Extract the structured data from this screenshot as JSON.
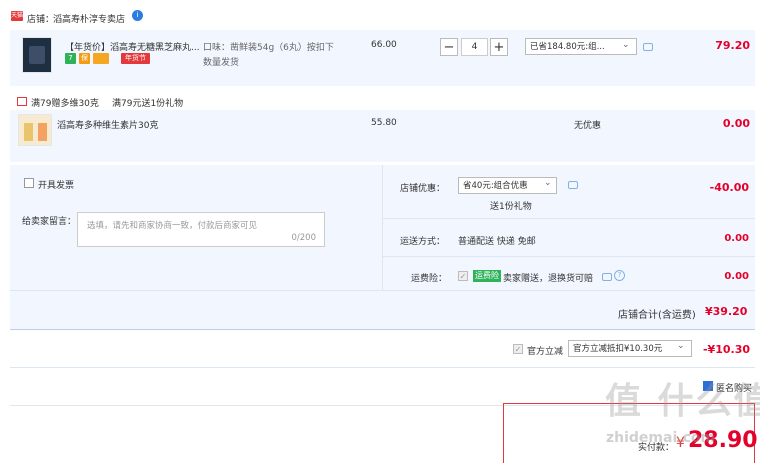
{
  "store": {
    "badge": "天猫",
    "label": "店铺：",
    "name": "滔高寿朴淳专卖店",
    "badge2": "i"
  },
  "item1": {
    "title": "【年货价】滔高寿无糖黑芝麻丸...",
    "tags": [
      "7",
      "保",
      "",
      "年货节"
    ],
    "spec": "口味：凿鲜装54g（6丸）按扣下",
    "spec2": "数量发货",
    "price": "66.00",
    "qty": "4",
    "qty_minus": "−",
    "qty_plus": "+",
    "discount": "已省184.80元:组...",
    "subtotal": "79.20"
  },
  "promo": {
    "text1": "满79赠多维30克",
    "text2": "满79元送1份礼物"
  },
  "item2": {
    "title": "滔高寿多种维生素片30克",
    "price": "55.80",
    "discount": "无优惠",
    "subtotal": "0.00"
  },
  "invoice": {
    "label": "开具发票"
  },
  "message": {
    "label": "给卖家留言：",
    "placeholder": "选填，请先和商家协商一致，付款后商家可见",
    "counter": "0/200"
  },
  "shop_discount": {
    "label": "店铺优惠：",
    "select": "省40元:组合优惠",
    "note": "送1份礼物",
    "amount": "-40.00"
  },
  "shipping": {
    "label": "运送方式：",
    "value": "普通配送 快递 免邮",
    "amount": "0.00"
  },
  "freight_insurance": {
    "label": "运费险：",
    "badge": "运费险",
    "value": "卖家赠送，退换货可赔",
    "amount": "0.00"
  },
  "store_total": {
    "label": "店铺合计(含运费)",
    "amount": "¥39.20"
  },
  "official": {
    "label": "官方立减",
    "select": "官方立减抵扣¥10.30元",
    "amount": "-¥10.30"
  },
  "footer": {
    "anonymous": "匿名购买",
    "pay_label": "实付款：",
    "pay_currency": "¥",
    "pay_amount": "28.90",
    "watermark": "值 什么值得买",
    "watermark_url": "zhidemai.com"
  }
}
